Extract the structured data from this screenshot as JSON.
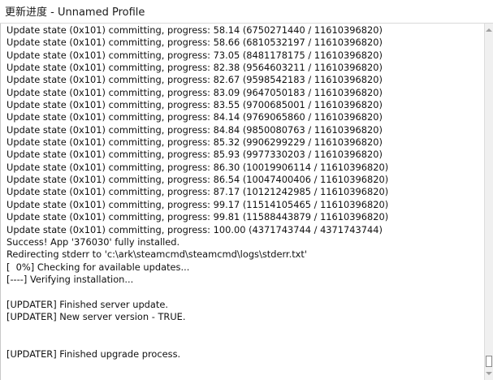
{
  "window": {
    "title": "更新进度 - Unnamed Profile"
  },
  "log": {
    "lines": [
      "Update state (0x101) committing, progress: 58.14 (6750271440 / 11610396820)",
      "Update state (0x101) committing, progress: 58.66 (6810532197 / 11610396820)",
      "Update state (0x101) committing, progress: 73.05 (8481178175 / 11610396820)",
      "Update state (0x101) committing, progress: 82.38 (9564603211 / 11610396820)",
      "Update state (0x101) committing, progress: 82.67 (9598542183 / 11610396820)",
      "Update state (0x101) committing, progress: 83.09 (9647050183 / 11610396820)",
      "Update state (0x101) committing, progress: 83.55 (9700685001 / 11610396820)",
      "Update state (0x101) committing, progress: 84.14 (9769065860 / 11610396820)",
      "Update state (0x101) committing, progress: 84.84 (9850080763 / 11610396820)",
      "Update state (0x101) committing, progress: 85.32 (9906299229 / 11610396820)",
      "Update state (0x101) committing, progress: 85.93 (9977330203 / 11610396820)",
      "Update state (0x101) committing, progress: 86.30 (10019906114 / 11610396820)",
      "Update state (0x101) committing, progress: 86.54 (10047400406 / 11610396820)",
      "Update state (0x101) committing, progress: 87.17 (10121242985 / 11610396820)",
      "Update state (0x101) committing, progress: 99.17 (11514105465 / 11610396820)",
      "Update state (0x101) committing, progress: 99.81 (11588443879 / 11610396820)",
      "Update state (0x101) committing, progress: 100.00 (4371743744 / 4371743744)",
      "Success! App '376030' fully installed.",
      "Redirecting stderr to 'c:\\ark\\steamcmd\\steamcmd\\logs\\stderr.txt'",
      "[  0%] Checking for available updates...",
      "[----] Verifying installation...",
      "",
      "[UPDATER] Finished server update.",
      "[UPDATER] New server version - TRUE.",
      "",
      "",
      "[UPDATER] Finished upgrade process."
    ]
  },
  "scrollbar": {
    "up_icon": "chevron-up-icon",
    "down_icon": "chevron-down-icon"
  }
}
